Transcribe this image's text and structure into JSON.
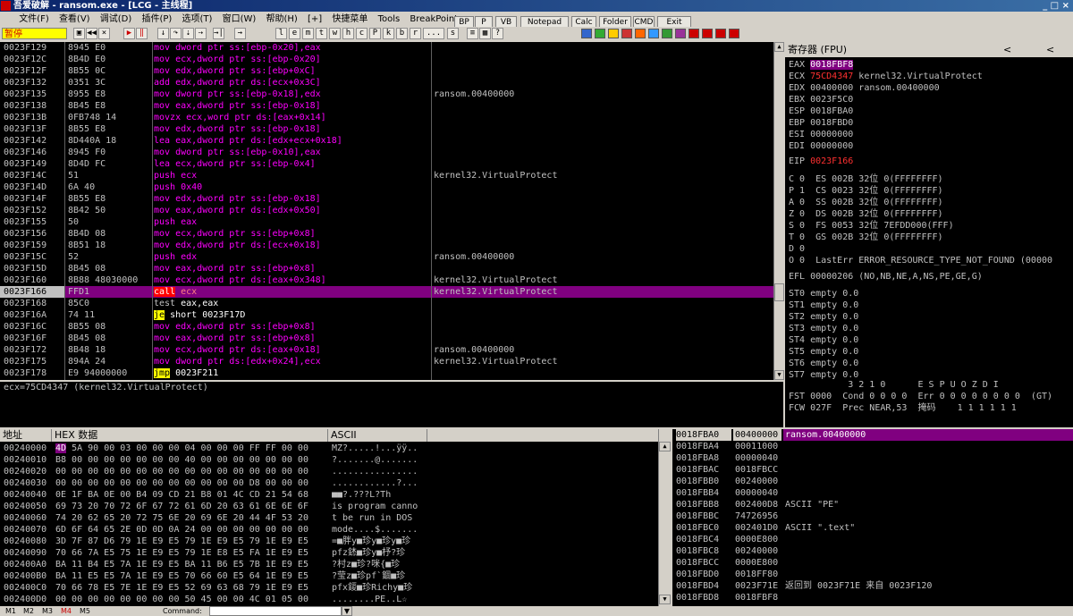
{
  "window": {
    "title": "吾爱破解 - ransom.exe - [LCG - 主线程]"
  },
  "menu": [
    "文件(F)",
    "查看(V)",
    "调试(D)",
    "插件(P)",
    "选项(T)",
    "窗口(W)",
    "帮助(H)",
    "[+]",
    "快捷菜单",
    "Tools",
    "BreakPoint->"
  ],
  "menu_buttons": [
    "BP",
    "P",
    "VB",
    "Notepad",
    "Calc",
    "Folder",
    "CMD",
    "Exit"
  ],
  "toolbar": {
    "status": "暂停",
    "letters": [
      "l",
      "e",
      "m",
      "t",
      "w",
      "h",
      "c",
      "P",
      "k",
      "b",
      "r",
      "...",
      "s"
    ]
  },
  "disasm": [
    {
      "addr": "0023F129",
      "hex": "8945 E0",
      "mn": "mov",
      "ops": "dword ptr ss:[ebp-0x20],eax",
      "com": ""
    },
    {
      "addr": "0023F12C",
      "hex": "8B4D E0",
      "mn": "mov",
      "ops": "ecx,dword ptr ss:[ebp-0x20]",
      "com": ""
    },
    {
      "addr": "0023F12F",
      "hex": "8B55 0C",
      "mn": "mov",
      "ops": "edx,dword ptr ss:[ebp+0xC]",
      "com": ""
    },
    {
      "addr": "0023F132",
      "hex": "0351 3C",
      "mn": "add",
      "ops": "edx,dword ptr ds:[ecx+0x3C]",
      "com": ""
    },
    {
      "addr": "0023F135",
      "hex": "8955 E8",
      "mn": "mov",
      "ops": "dword ptr ss:[ebp-0x18],edx",
      "com": "ransom.00400000"
    },
    {
      "addr": "0023F138",
      "hex": "8B45 E8",
      "mn": "mov",
      "ops": "eax,dword ptr ss:[ebp-0x18]",
      "com": ""
    },
    {
      "addr": "0023F13B",
      "hex": "0FB748 14",
      "mn": "movzx",
      "ops": "ecx,word ptr ds:[eax+0x14]",
      "com": ""
    },
    {
      "addr": "0023F13F",
      "hex": "8B55 E8",
      "mn": "mov",
      "ops": "edx,dword ptr ss:[ebp-0x18]",
      "com": ""
    },
    {
      "addr": "0023F142",
      "hex": "8D440A 18",
      "mn": "lea",
      "ops": "eax,dword ptr ds:[edx+ecx+0x18]",
      "com": ""
    },
    {
      "addr": "0023F146",
      "hex": "8945 F0",
      "mn": "mov",
      "ops": "dword ptr ss:[ebp-0x10],eax",
      "com": ""
    },
    {
      "addr": "0023F149",
      "hex": "8D4D FC",
      "mn": "lea",
      "ops": "ecx,dword ptr ss:[ebp-0x4]",
      "com": ""
    },
    {
      "addr": "0023F14C",
      "hex": "51",
      "mn": "push",
      "ops": "ecx",
      "com": "kernel32.VirtualProtect"
    },
    {
      "addr": "0023F14D",
      "hex": "6A 40",
      "mn": "push",
      "ops": "0x40",
      "com": ""
    },
    {
      "addr": "0023F14F",
      "hex": "8B55 E8",
      "mn": "mov",
      "ops": "edx,dword ptr ss:[ebp-0x18]",
      "com": ""
    },
    {
      "addr": "0023F152",
      "hex": "8B42 50",
      "mn": "mov",
      "ops": "eax,dword ptr ds:[edx+0x50]",
      "com": ""
    },
    {
      "addr": "0023F155",
      "hex": "50",
      "mn": "push",
      "ops": "eax",
      "com": ""
    },
    {
      "addr": "0023F156",
      "hex": "8B4D 08",
      "mn": "mov",
      "ops": "ecx,dword ptr ss:[ebp+0x8]",
      "com": ""
    },
    {
      "addr": "0023F159",
      "hex": "8B51 18",
      "mn": "mov",
      "ops": "edx,dword ptr ds:[ecx+0x18]",
      "com": ""
    },
    {
      "addr": "0023F15C",
      "hex": "52",
      "mn": "push",
      "ops": "edx",
      "com": "ransom.00400000"
    },
    {
      "addr": "0023F15D",
      "hex": "8B45 08",
      "mn": "mov",
      "ops": "eax,dword ptr ss:[ebp+0x8]",
      "com": ""
    },
    {
      "addr": "0023F160",
      "hex": "8B88 48030000",
      "mn": "mov",
      "ops": "ecx,dword ptr ds:[eax+0x348]",
      "com": "kernel32.VirtualProtect"
    },
    {
      "addr": "0023F166",
      "hex": "FFD1",
      "mn": "call",
      "ops": "ecx",
      "com": "kernel32.VirtualProtect"
    },
    {
      "addr": "0023F168",
      "hex": "85C0",
      "mn": "test",
      "ops": "eax,eax",
      "com": ""
    },
    {
      "addr": "0023F16A",
      "hex": "74 11",
      "mn": "je",
      "ops": "short 0023F17D",
      "com": ""
    },
    {
      "addr": "0023F16C",
      "hex": "8B55 08",
      "mn": "mov",
      "ops": "edx,dword ptr ss:[ebp+0x8]",
      "com": ""
    },
    {
      "addr": "0023F16F",
      "hex": "8B45 08",
      "mn": "mov",
      "ops": "eax,dword ptr ss:[ebp+0x8]",
      "com": ""
    },
    {
      "addr": "0023F172",
      "hex": "8B48 18",
      "mn": "mov",
      "ops": "ecx,dword ptr ds:[eax+0x18]",
      "com": "ransom.00400000"
    },
    {
      "addr": "0023F175",
      "hex": "894A 24",
      "mn": "mov",
      "ops": "dword ptr ds:[edx+0x24],ecx",
      "com": "kernel32.VirtualProtect"
    },
    {
      "addr": "0023F178",
      "hex": "E9 94000000",
      "mn": "jmp",
      "ops": "0023F211",
      "com": ""
    }
  ],
  "info_line": "ecx=75CD4347 (kernel32.VirtualProtect)",
  "registers": {
    "header": "寄存器 (FPU)",
    "eax": {
      "name": "EAX",
      "val": "0018FBF8"
    },
    "gprs": [
      {
        "name": "ECX",
        "val": "75CD4347",
        "note": "kernel32.VirtualProtect"
      },
      {
        "name": "EDX",
        "val": "00400000",
        "note": "ransom.00400000"
      },
      {
        "name": "EBX",
        "val": "0023F5C0",
        "note": ""
      },
      {
        "name": "ESP",
        "val": "0018FBA0",
        "note": ""
      },
      {
        "name": "EBP",
        "val": "0018FBD0",
        "note": ""
      },
      {
        "name": "ESI",
        "val": "00000000",
        "note": ""
      },
      {
        "name": "EDI",
        "val": "00000000",
        "note": ""
      }
    ],
    "eip": {
      "name": "EIP",
      "val": "0023F166"
    },
    "flags": [
      "C 0  ES 002B 32位 0(FFFFFFFF)",
      "P 1  CS 0023 32位 0(FFFFFFFF)",
      "A 0  SS 002B 32位 0(FFFFFFFF)",
      "Z 0  DS 002B 32位 0(FFFFFFFF)",
      "S 0  FS 0053 32位 7EFDD000(FFF)",
      "T 0  GS 002B 32位 0(FFFFFFFF)",
      "D 0",
      "O 0  LastErr ERROR_RESOURCE_TYPE_NOT_FOUND (00000"
    ],
    "efl": "EFL 00000206 (NO,NB,NE,A,NS,PE,GE,G)",
    "fpu": [
      "ST0 empty 0.0",
      "ST1 empty 0.0",
      "ST2 empty 0.0",
      "ST3 empty 0.0",
      "ST4 empty 0.0",
      "ST5 empty 0.0",
      "ST6 empty 0.0",
      "ST7 empty 0.0"
    ],
    "fpu_bits": "           3 2 1 0      E S P U O Z D I",
    "fst": "FST 0000  Cond 0 0 0 0  Err 0 0 0 0 0 0 0 0  (GT)",
    "fcw": "FCW 027F  Prec NEAR,53  掩码    1 1 1 1 1 1"
  },
  "dump": {
    "headers": [
      "地址",
      "HEX 数据",
      "ASCII"
    ],
    "rows": [
      {
        "addr": "00240000",
        "hex": "4D 5A 90 00 03 00 00 00 04 00 00 00 FF FF 00 00",
        "ascii": "MZ?.....!...ÿÿ.."
      },
      {
        "addr": "00240010",
        "hex": "B8 00 00 00 00 00 00 00 40 00 00 00 00 00 00 00",
        "ascii": "?.......@......."
      },
      {
        "addr": "00240020",
        "hex": "00 00 00 00 00 00 00 00 00 00 00 00 00 00 00 00",
        "ascii": "................"
      },
      {
        "addr": "00240030",
        "hex": "00 00 00 00 00 00 00 00 00 00 00 00 D8 00 00 00",
        "ascii": "............?..."
      },
      {
        "addr": "00240040",
        "hex": "0E 1F BA 0E 00 B4 09 CD 21 B8 01 4C CD 21 54 68",
        "ascii": "■■?.???L?Th"
      },
      {
        "addr": "00240050",
        "hex": "69 73 20 70 72 6F 67 72 61 6D 20 63 61 6E 6E 6F",
        "ascii": "is program canno"
      },
      {
        "addr": "00240060",
        "hex": "74 20 62 65 20 72 75 6E 20 69 6E 20 44 4F 53 20",
        "ascii": "t be run in DOS "
      },
      {
        "addr": "00240070",
        "hex": "6D 6F 64 65 2E 0D 0D 0A 24 00 00 00 00 00 00 00",
        "ascii": "mode....$......."
      },
      {
        "addr": "00240080",
        "hex": "3D 7F 87 D6 79 1E E9 E5 79 1E E9 E5 79 1E E9 E5",
        "ascii": "=■胖y■珍y■珍y■珍"
      },
      {
        "addr": "00240090",
        "hex": "70 66 7A E5 75 1E E9 E5 79 1E E8 E5 FA 1E E9 E5",
        "ascii": "pfz錰■珍y■杼?珍"
      },
      {
        "addr": "002400A0",
        "hex": "BA 11 B4 E5 7A 1E E9 E5 BA 11 B6 E5 7B 1E E9 E5",
        "ascii": "?村z■珍?咪{■珍"
      },
      {
        "addr": "002400B0",
        "hex": "BA 11 E5 E5 7A 1E E9 E5 70 66 60 E5 64 1E E9 E5",
        "ascii": "?莹z■珍pf`錮■珍"
      },
      {
        "addr": "002400C0",
        "hex": "70 66 78 E5 7E 1E E9 E5 52 69 63 68 79 1E E9 E5",
        "ascii": "pfx錽■珍Richy■珍"
      },
      {
        "addr": "002400D0",
        "hex": "00 00 00 00 00 00 00 00 50 45 00 00 4C 01 05 00",
        "ascii": "........PE..L☆"
      }
    ]
  },
  "stack": [
    {
      "addr": "0018FBA0",
      "val": "00400000",
      "com": "ransom.00400000"
    },
    {
      "addr": "0018FBA4",
      "val": "00011000",
      "com": ""
    },
    {
      "addr": "0018FBA8",
      "val": "00000040",
      "com": ""
    },
    {
      "addr": "0018FBAC",
      "val": "0018FBCC",
      "com": ""
    },
    {
      "addr": "0018FBB0",
      "val": "00240000",
      "com": ""
    },
    {
      "addr": "0018FBB4",
      "val": "00000040",
      "com": ""
    },
    {
      "addr": "0018FBB8",
      "val": "002400D8",
      "com": "ASCII \"PE\""
    },
    {
      "addr": "0018FBBC",
      "val": "74726956",
      "com": ""
    },
    {
      "addr": "0018FBC0",
      "val": "002401D0",
      "com": "ASCII \".text\""
    },
    {
      "addr": "0018FBC4",
      "val": "0000E800",
      "com": ""
    },
    {
      "addr": "0018FBC8",
      "val": "00240000",
      "com": ""
    },
    {
      "addr": "0018FBCC",
      "val": "0000E800",
      "com": ""
    },
    {
      "addr": "0018FBD0",
      "val": "0018FF80",
      "com": ""
    },
    {
      "addr": "0018FBD4",
      "val": "0023F71E",
      "com": "返回到 0023F71E 来自 0023F120"
    },
    {
      "addr": "0018FBD8",
      "val": "0018FBF8",
      "com": ""
    }
  ],
  "bottom": {
    "marks": [
      "M1",
      "M2",
      "M3",
      "M4",
      "M5"
    ],
    "command_label": "Command:",
    "command_value": ""
  },
  "colors": {
    "mnem_mov": "#ff00ff",
    "mnem_push": "#ff00ff",
    "mnem_call": "#ff4040",
    "mnem_jmp": "#ffff00",
    "selection": "#800080",
    "register_changed": "#ff3030"
  }
}
